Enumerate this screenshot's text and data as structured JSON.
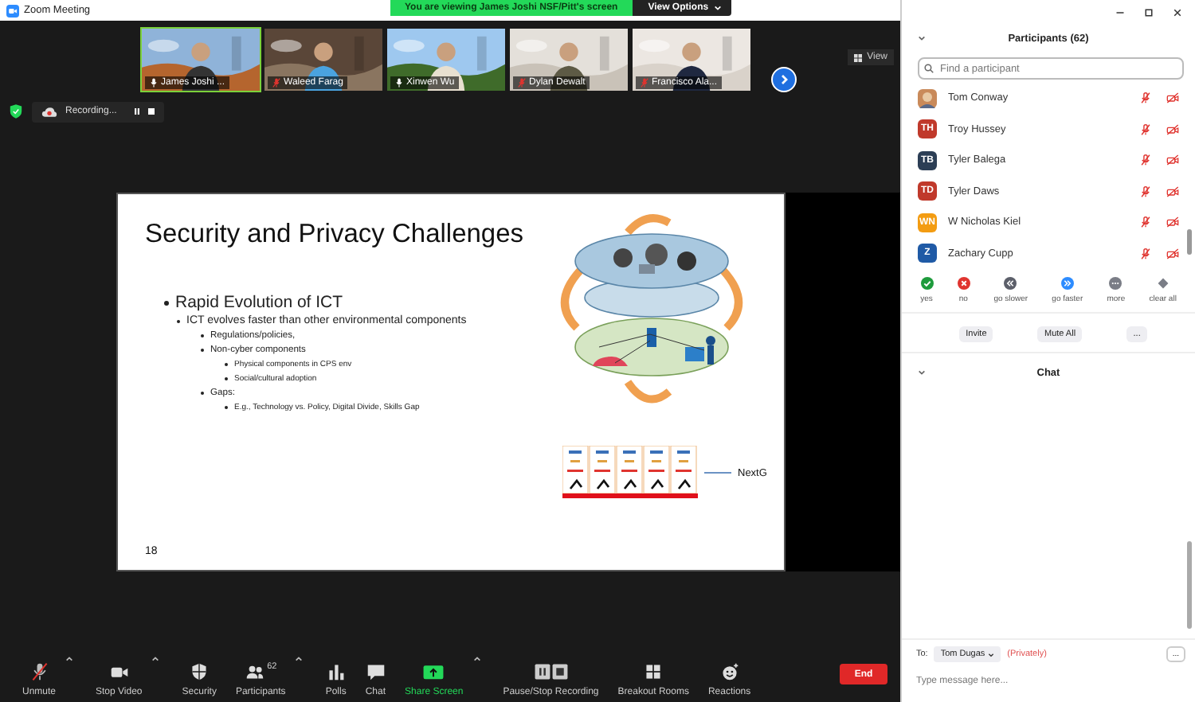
{
  "window": {
    "title": "Zoom Meeting"
  },
  "share_banner": {
    "text": "You are viewing James Joshi NSF/Pitt's screen",
    "options": "View Options"
  },
  "videos": [
    {
      "name": "James Joshi ...",
      "speaking": true,
      "muted": false
    },
    {
      "name": "Waleed Farag",
      "speaking": false,
      "muted": true
    },
    {
      "name": "Xinwen Wu",
      "speaking": false,
      "muted": false
    },
    {
      "name": "Dylan Dewalt",
      "speaking": false,
      "muted": true
    },
    {
      "name": "Francisco Ala...",
      "speaking": false,
      "muted": true
    }
  ],
  "view_button": "View",
  "recording": {
    "label": "Recording..."
  },
  "slide": {
    "title": "Security and Privacy Challenges",
    "number": "18",
    "callout": "NextG",
    "bullets": [
      {
        "text": "Rapid Evolution of ICT",
        "children": [
          {
            "text": "ICT evolves faster than other environmental components",
            "children": [
              {
                "text": "Regulations/policies,"
              },
              {
                "text": "Non-cyber components",
                "children": [
                  {
                    "text": "Physical components in CPS env"
                  },
                  {
                    "text": "Social/cultural adoption"
                  }
                ]
              },
              {
                "text": "Gaps:",
                "children": [
                  {
                    "text": "E.g., Technology vs. Policy, Digital Divide, Skills Gap"
                  }
                ]
              }
            ]
          }
        ]
      }
    ]
  },
  "toolbar": [
    {
      "kind": "mic",
      "label": "Unmute",
      "menu": true
    },
    {
      "kind": "video",
      "label": "Stop Video",
      "menu": true
    },
    {
      "kind": "security",
      "label": "Security",
      "menu": false
    },
    {
      "kind": "participants",
      "label": "Participants",
      "count": "62",
      "menu": true
    },
    {
      "kind": "polls",
      "label": "Polls",
      "menu": false
    },
    {
      "kind": "chat",
      "label": "Chat",
      "menu": false
    },
    {
      "kind": "share",
      "label": "Share Screen",
      "menu": true
    },
    {
      "kind": "recording",
      "label": "Pause/Stop Recording",
      "menu": false
    },
    {
      "kind": "breakout",
      "label": "Breakout Rooms",
      "menu": false
    },
    {
      "kind": "reactions",
      "label": "Reactions",
      "menu": false
    }
  ],
  "end_button": "End",
  "participants": {
    "title": "Participants (62)",
    "search": {
      "placeholder": "Find a participant"
    },
    "people": [
      {
        "name": "Tom Conway",
        "muted": true,
        "video_off": true
      },
      {
        "name": "Troy Hussey",
        "kind": "initials",
        "initials": "TH",
        "color": "#c0392b",
        "muted": true,
        "video_off": true
      },
      {
        "name": "Tyler Balega",
        "kind": "initials",
        "initials": "TB",
        "color": "#2c3e55",
        "muted": true,
        "video_off": true
      },
      {
        "name": "Tyler Daws",
        "kind": "initials",
        "initials": "TD",
        "color": "#c0392b",
        "muted": true,
        "video_off": true
      },
      {
        "name": "W Nicholas Kiel",
        "kind": "initials",
        "initials": "WN",
        "color": "#f39c12",
        "muted": true,
        "video_off": true
      },
      {
        "name": "Zachary Cupp",
        "kind": "initials",
        "initials": "Z",
        "color": "#1f5aa6",
        "muted": true,
        "video_off": true
      }
    ],
    "reactions": [
      {
        "kind": "yes",
        "label": "yes"
      },
      {
        "kind": "no",
        "label": "no"
      },
      {
        "kind": "slower",
        "label": "go slower"
      },
      {
        "kind": "faster",
        "label": "go faster"
      },
      {
        "kind": "more",
        "label": "more"
      },
      {
        "kind": "clear",
        "label": "clear all"
      }
    ],
    "buttons": [
      "Invite",
      "Mute All",
      "..."
    ]
  },
  "chat": {
    "title": "Chat",
    "to_label": "To:",
    "recipient": "Tom Dugas",
    "privacy": "(Privately)",
    "more": "...",
    "placeholder": "Type message here..."
  }
}
